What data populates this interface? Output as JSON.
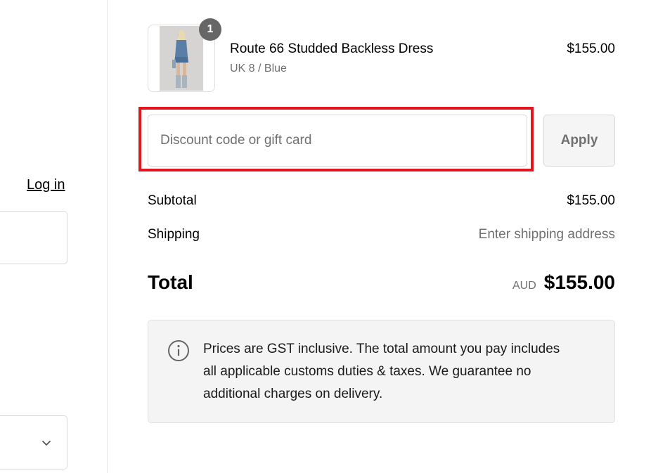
{
  "left_pane": {
    "login_link": "Log in"
  },
  "order": {
    "items": [
      {
        "name": "Route 66 Studded Backless Dress",
        "variant": "UK 8 / Blue",
        "price": "$155.00",
        "quantity": "1"
      }
    ]
  },
  "discount": {
    "placeholder": "Discount code or gift card",
    "apply_label": "Apply"
  },
  "summary": {
    "subtotal_label": "Subtotal",
    "subtotal_value": "$155.00",
    "shipping_label": "Shipping",
    "shipping_value": "Enter shipping address",
    "total_label": "Total",
    "currency": "AUD",
    "total_value": "$155.00"
  },
  "notice": {
    "icon": "info-icon",
    "text": "Prices are GST inclusive. The total amount you pay includes all applicable customs duties & taxes. We guarantee no additional charges on delivery."
  },
  "colors": {
    "highlight": "#e0151e",
    "badge": "#666666",
    "muted_text": "#707070",
    "notice_bg": "#f4f4f4"
  }
}
